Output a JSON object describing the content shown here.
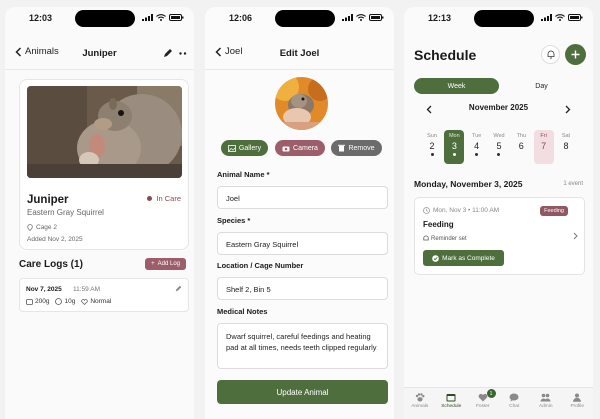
{
  "colors": {
    "primary": "#4f6e3e",
    "accent_rose": "#9c5e6a",
    "in_care": "#8a4a55",
    "bg": "#fafafa"
  },
  "panel1": {
    "time": "12:03",
    "back_label": "Animals",
    "title": "Juniper",
    "animal": {
      "name": "Juniper",
      "species": "Eastern Gray Squirrel",
      "status": "In Care",
      "cage": "Cage 2",
      "added": "Added Nov 2, 2025"
    },
    "care_logs_title": "Care Logs (1)",
    "add_log_label": "Add Log",
    "log": {
      "date": "Nov 7, 2025",
      "time": "11:59 AM",
      "weight": "200g",
      "feed": "10g",
      "condition": "Normal"
    }
  },
  "panel2": {
    "time": "12:06",
    "back_label": "Joel",
    "title": "Edit Joel",
    "photo_buttons": {
      "gallery": "Gallery",
      "camera": "Camera",
      "remove": "Remove"
    },
    "fields": {
      "animal_name": {
        "label": "Animal Name *",
        "value": "Joel"
      },
      "species": {
        "label": "Species *",
        "value": "Eastern Gray Squirrel"
      },
      "location": {
        "label": "Location / Cage Number",
        "value": "Shelf 2, Bin 5"
      },
      "medical": {
        "label": "Medical Notes",
        "value": "Dwarf squirrel, careful feedings and heating pad at all times, needs teeth clipped regularly"
      }
    },
    "submit_label": "Update Animal"
  },
  "panel3": {
    "time": "12:13",
    "title": "Schedule",
    "segments": {
      "week": "Week",
      "day": "Day"
    },
    "month": "November 2025",
    "days": [
      {
        "name": "Sun",
        "num": "2",
        "dot": true
      },
      {
        "name": "Mon",
        "num": "3",
        "dot": true,
        "selected": true
      },
      {
        "name": "Tue",
        "num": "4",
        "dot": true
      },
      {
        "name": "Wed",
        "num": "5",
        "dot": true
      },
      {
        "name": "Thu",
        "num": "6",
        "dot": false
      },
      {
        "name": "Fri",
        "num": "7",
        "dot": false,
        "today": true
      },
      {
        "name": "Sat",
        "num": "8",
        "dot": false
      }
    ],
    "date_heading": "Monday, November 3, 2025",
    "event_count": "1 event",
    "event": {
      "when": "Mon, Nov 3 • 11:00 AM",
      "tag": "Feeding",
      "title": "Feeding",
      "reminder": "Reminder set",
      "action": "Mark as Complete"
    },
    "tabs": [
      {
        "label": "Animals",
        "icon": "paw-icon"
      },
      {
        "label": "Schedule",
        "icon": "calendar-icon",
        "active": true
      },
      {
        "label": "Foster",
        "icon": "heart-icon",
        "badge": "1"
      },
      {
        "label": "Chat",
        "icon": "chat-icon"
      },
      {
        "label": "Admin",
        "icon": "people-icon"
      },
      {
        "label": "Profile",
        "icon": "person-icon"
      }
    ]
  }
}
